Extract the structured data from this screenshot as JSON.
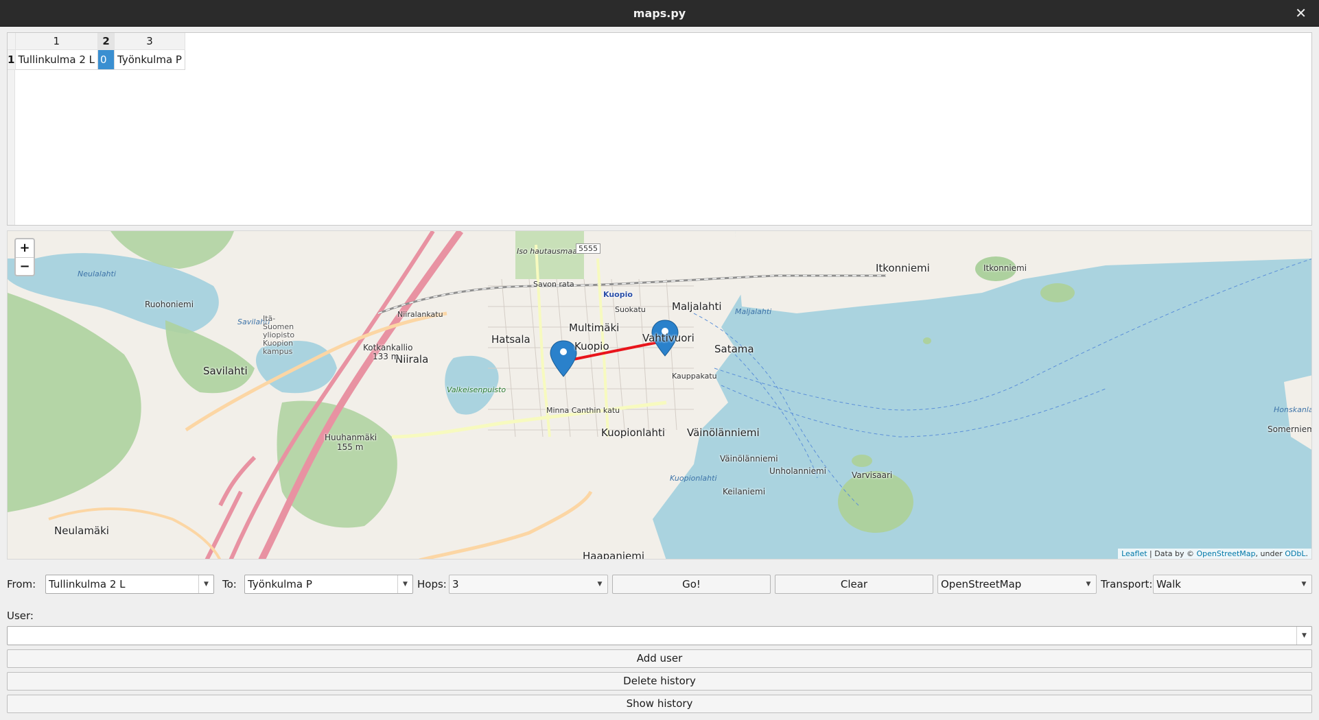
{
  "window": {
    "title": "maps.py",
    "close_glyph": "✕"
  },
  "table": {
    "columns": [
      "1",
      "2",
      "3"
    ],
    "selected_column": "2",
    "rows": [
      {
        "header": "1",
        "cells": [
          "Tullinkulma 2 L",
          "0",
          "Työnkulma P"
        ]
      }
    ]
  },
  "map": {
    "zoom_in": "+",
    "zoom_out": "−",
    "attribution": {
      "leaflet": "Leaflet",
      "sep1": " | Data by © ",
      "osm": "OpenStreetMap",
      "sep2": ", under ",
      "odbl": "ODbL",
      "end": "."
    },
    "labels": {
      "kuopio": "Kuopio",
      "kuopio_badge": "Kuopio",
      "multimaki": "Multimäki",
      "hatsala": "Hatsala",
      "vahtivuori": "Vahtivuori",
      "satama": "Satama",
      "maljalahti": "Maljalahti",
      "niirala": "Niirala",
      "savilahti": "Savilahti",
      "neulamaki": "Neulamäki",
      "ruohoniemi": "Ruohoniemi",
      "itkonniemi": "Itkonniemi",
      "itkonniemi2": "Itkonniemi",
      "kuopionlahti": "Kuopionlahti",
      "vainolanniemi": "Väinölänniemi",
      "vainolanniemi2": "Väinölänniemi",
      "unholanniemi": "Unholanniemi",
      "keilaniemi": "Keilaniemi",
      "varvisaari": "Varvisaari",
      "somerniemi": "Somerniemi",
      "huuhanmaki": "Huuhanmäki",
      "huuhanmaki_h": "155 m",
      "kotkankallio": "Kotkankallio",
      "kotkankallio_h": "133 m",
      "valkeisenpuisto": "Valkeisenpuisto",
      "iso_hautausmaa": "Iso hautausmaa",
      "minna_canthin_katu": "Minna Canthin katu",
      "savon_rata": "Savon rata",
      "neulalahti": "Neulalahti",
      "savilahti_w": "Savilahti",
      "kuopionlahti_w": "Kuopionlahti",
      "maljalahti_w": "Maljalahti",
      "honskanlahti": "Honskanlahti",
      "haapaniemi": "Haapaniemi",
      "campus": "Itä-Suomen yliopisto Kuopion kampus",
      "road_5555": "5555",
      "suokatu": "Suokatu",
      "kauppakatu": "Kauppakatu",
      "niiralankatu": "Niiralankatu"
    }
  },
  "route": {
    "from_marker": "Tullinkulma 2 L",
    "to_marker": "Työnkulma P",
    "line_color": "#e8141b",
    "marker_color": "#2a81cb"
  },
  "controls": {
    "from_label": "From:",
    "from_value": "Tullinkulma 2 L",
    "to_label": "To:",
    "to_value": "Työnkulma P",
    "hops_label": "Hops:",
    "hops_value": "3",
    "go_label": "Go!",
    "clear_label": "Clear",
    "tile_value": "OpenStreetMap",
    "transport_label": "Transport:",
    "transport_value": "Walk",
    "user_label": "User:",
    "user_value": "",
    "add_user_label": "Add user",
    "delete_history_label": "Delete history",
    "show_history_label": "Show history"
  },
  "colors": {
    "water": "#aad3df",
    "land": "#f2efe9",
    "forest": "#add19e",
    "motorway": "#e892a2",
    "primary": "#fcd6a4"
  }
}
